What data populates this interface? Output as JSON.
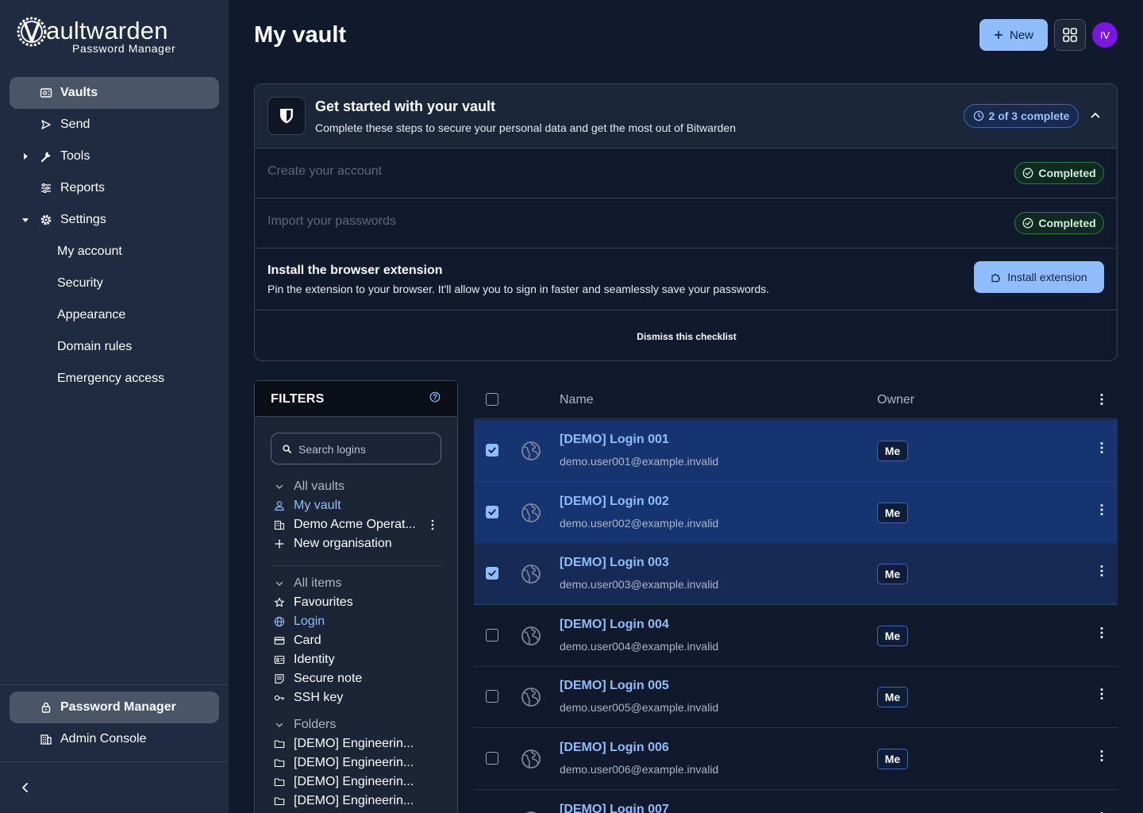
{
  "app": {
    "logo_word": "aultwarden",
    "logo_sub": "Password Manager"
  },
  "sidebar": {
    "items": [
      {
        "label": "Vaults",
        "icon": "vault-icon",
        "active": true
      },
      {
        "label": "Send",
        "icon": "send-icon"
      },
      {
        "label": "Tools",
        "icon": "wrench-icon",
        "caret": "collapsed"
      },
      {
        "label": "Reports",
        "icon": "reports-icon"
      },
      {
        "label": "Settings",
        "icon": "gear-icon",
        "caret": "expanded"
      }
    ],
    "settings_children": [
      "My account",
      "Security",
      "Appearance",
      "Domain rules",
      "Emergency access"
    ],
    "products": [
      {
        "label": "Password Manager",
        "icon": "lock-icon",
        "active": true
      },
      {
        "label": "Admin Console",
        "icon": "building-icon"
      }
    ]
  },
  "header": {
    "title": "My vault",
    "new_label": "New",
    "avatar_initials": "IV",
    "avatar_color": "#7b16e0"
  },
  "checklist": {
    "title": "Get started with your vault",
    "subtitle": "Complete these steps to secure your personal data and get the most out of Bitwarden",
    "progress": "2 of 3 complete",
    "steps_done": [
      {
        "title": "Create your account",
        "status": "Completed"
      },
      {
        "title": "Import your passwords",
        "status": "Completed"
      }
    ],
    "extension": {
      "title": "Install the browser extension",
      "desc": "Pin the extension to your browser. It'll allow you to sign in faster and seamlessly save your passwords.",
      "button": "Install extension"
    },
    "dismiss": "Dismiss this checklist"
  },
  "filters": {
    "title": "FILTERS",
    "search_placeholder": "Search logins",
    "vaults_header": "All vaults",
    "vaults": [
      {
        "label": "My vault",
        "icon": "person-icon",
        "selected": true
      },
      {
        "label": "Demo Acme Operat...",
        "icon": "building-icon"
      },
      {
        "label": "New organisation",
        "icon": "plus-icon"
      }
    ],
    "items_header": "All items",
    "types": [
      {
        "label": "Favourites",
        "icon": "star-icon"
      },
      {
        "label": "Login",
        "icon": "globe-icon",
        "selected": true
      },
      {
        "label": "Card",
        "icon": "card-icon"
      },
      {
        "label": "Identity",
        "icon": "id-card-icon"
      },
      {
        "label": "Secure note",
        "icon": "note-icon"
      },
      {
        "label": "SSH key",
        "icon": "key-icon"
      }
    ],
    "folders_header": "Folders",
    "folders": [
      "[DEMO] Engineerin...",
      "[DEMO] Engineerin...",
      "[DEMO] Engineerin...",
      "[DEMO] Engineerin..."
    ]
  },
  "table": {
    "col_name": "Name",
    "col_owner": "Owner",
    "rows": [
      {
        "name": "[DEMO] Login 001",
        "user": "demo.user001@example.invalid",
        "owner": "Me",
        "checked": true
      },
      {
        "name": "[DEMO] Login 002",
        "user": "demo.user002@example.invalid",
        "owner": "Me",
        "checked": true
      },
      {
        "name": "[DEMO] Login 003",
        "user": "demo.user003@example.invalid",
        "owner": "Me",
        "checked": true
      },
      {
        "name": "[DEMO] Login 004",
        "user": "demo.user004@example.invalid",
        "owner": "Me",
        "checked": false
      },
      {
        "name": "[DEMO] Login 005",
        "user": "demo.user005@example.invalid",
        "owner": "Me",
        "checked": false
      },
      {
        "name": "[DEMO] Login 006",
        "user": "demo.user006@example.invalid",
        "owner": "Me",
        "checked": false
      },
      {
        "name": "[DEMO] Login 007",
        "user": "",
        "owner": "",
        "checked": false
      }
    ]
  },
  "colors": {
    "accent": "#8fbdff",
    "sidebar_bg": "#1f2b40",
    "page_bg": "#111a2c",
    "selected_row": "#163470",
    "completed_green": "#2d7a4a"
  }
}
